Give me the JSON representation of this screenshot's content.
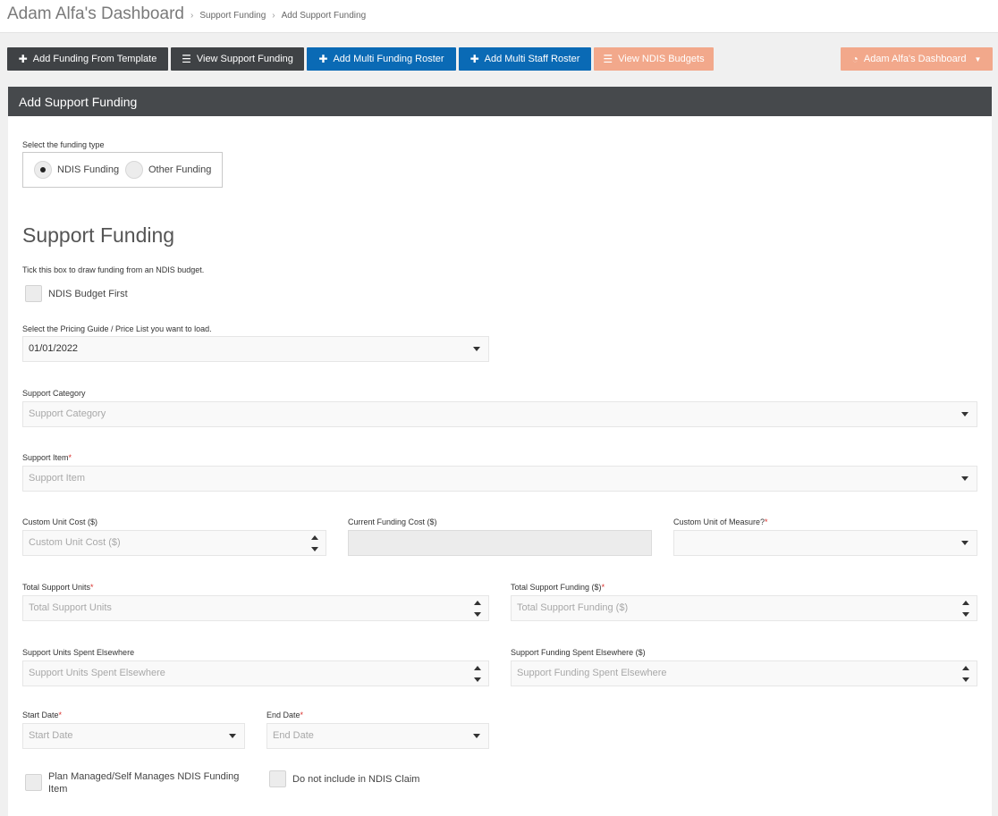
{
  "header": {
    "title": "Adam Alfa's Dashboard",
    "breadcrumb": [
      "Support Funding",
      "Add Support Funding"
    ]
  },
  "toolbar": {
    "add_template": "Add Funding From Template",
    "view_funding": "View Support Funding",
    "multi_funding": "Add Multi Funding Roster",
    "multi_staff": "Add Multi Staff Roster",
    "view_budgets": "View NDIS Budgets",
    "dashboard_menu": "Adam Alfa's Dashboard"
  },
  "colors": {
    "dark": "#3f4245",
    "blue": "#0a6ab5",
    "peach": "#f2a88b",
    "panel_header": "#46494c",
    "required": "#d9302c"
  },
  "icons": {
    "add": "plus-icon",
    "list": "list-icon",
    "dashboard": "dashboard-gauge-icon",
    "dropdown": "caret-down-icon",
    "spinner": "spinner-arrows-icon"
  },
  "panel": {
    "heading": "Add Support Funding"
  },
  "form": {
    "funding_type_label": "Select the funding type",
    "funding_types": [
      "NDIS Funding",
      "Other Funding"
    ],
    "selected_funding_type": "NDIS Funding",
    "section_title": "Support Funding",
    "ndis_budget_hint": "Tick this box to draw funding from an NDIS budget.",
    "ndis_budget_first": "NDIS Budget First",
    "pricing_guide_label": "Select the Pricing Guide / Price List you want to load.",
    "pricing_guide_value": "01/01/2022",
    "support_category_label": "Support Category",
    "support_category_placeholder": "Support Category",
    "support_item_label": "Support Item",
    "support_item_placeholder": "Support Item",
    "custom_unit_cost_label": "Custom Unit Cost ($)",
    "custom_unit_cost_placeholder": "Custom Unit Cost ($)",
    "current_funding_cost_label": "Current Funding Cost ($)",
    "custom_uom_label": "Custom Unit of Measure?",
    "total_units_label": "Total Support Units",
    "total_units_placeholder": "Total Support Units",
    "total_funding_label": "Total Support Funding ($)",
    "total_funding_placeholder": "Total Support Funding ($)",
    "units_elsewhere_label": "Support Units Spent Elsewhere",
    "units_elsewhere_placeholder": "Support Units Spent Elsewhere",
    "funding_elsewhere_label": "Support Funding Spent Elsewhere ($)",
    "funding_elsewhere_placeholder": "Support Funding Spent Elsewhere",
    "start_date_label": "Start Date",
    "start_date_placeholder": "Start Date",
    "end_date_label": "End Date",
    "end_date_placeholder": "End Date",
    "plan_managed_label": "Plan Managed/Self Manages NDIS Funding Item",
    "no_claim_label": "Do not include in NDIS Claim",
    "required_mark": "*"
  }
}
